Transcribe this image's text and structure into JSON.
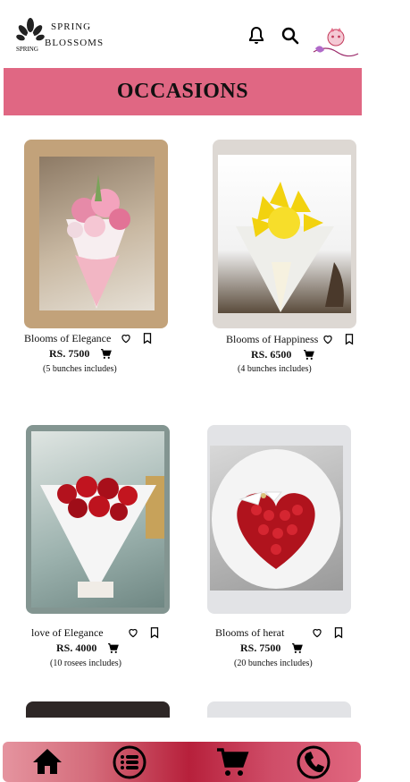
{
  "brand": {
    "name_line1": "SPRING",
    "name_line2": "BLOSSOMS",
    "logo_text": "SPRING"
  },
  "header": {
    "icons": [
      "bell-icon",
      "search-icon",
      "avatar"
    ]
  },
  "banner": {
    "title": "OCCASIONS"
  },
  "products": [
    {
      "name": "Blooms of Elegance",
      "price": "RS. 7500",
      "note": "(5 bunches includes)"
    },
    {
      "name": "Blooms of Happiness",
      "price": "RS. 6500",
      "note": "(4 bunches includes)"
    },
    {
      "name": "love of Elegance",
      "price": "RS. 4000",
      "note": "(10 rosees includes)"
    },
    {
      "name": "Blooms of herat",
      "price": "RS. 7500",
      "note": "(20 bunches includes)"
    }
  ],
  "bottom_nav": {
    "items": [
      "home-icon",
      "list-icon",
      "cart-icon",
      "phone-icon"
    ]
  },
  "colors": {
    "banner": "#e06783",
    "nav_dark": "#b7203b",
    "nav_light": "#e5949f"
  }
}
